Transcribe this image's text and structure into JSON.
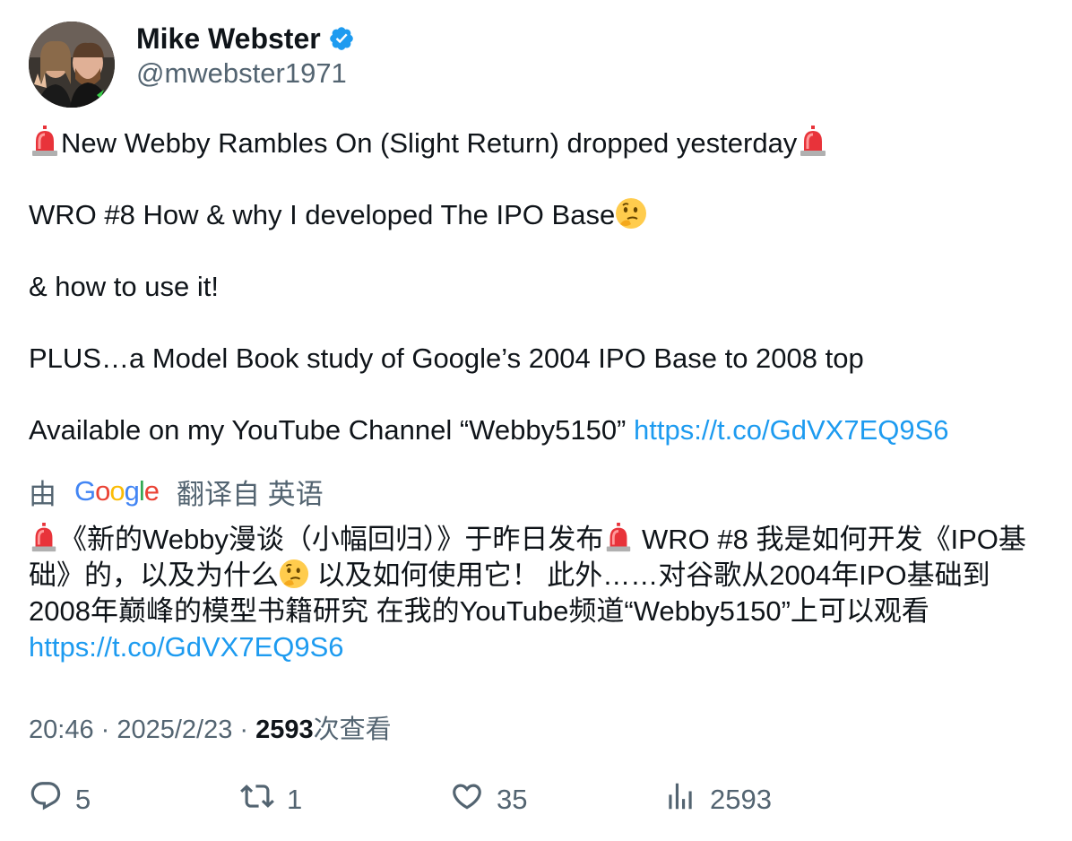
{
  "author": {
    "display_name": "Mike Webster",
    "handle": "@mwebster1971",
    "verified_icon": "verified-badge-icon",
    "avatar_icon": "avatar-photo"
  },
  "tweet": {
    "line1_text": "New Webby Rambles On (Slight Return) dropped yesterday",
    "line2_text": "WRO #8 How & why I developed The IPO Base",
    "line3_text": "& how to use it!",
    "line4_text": "PLUS…a Model Book study of Google’s 2004 IPO Base to 2008 top",
    "line5_text": "Available on my YouTube Channel “Webby5150” ",
    "link": "https://t.co/GdVX7EQ9S6",
    "emojis": [
      "rotating-light-emoji",
      "thinking-face-emoji"
    ]
  },
  "translation": {
    "prefix": "由",
    "provider": "Google",
    "suffix": "翻译自 英语",
    "part1": "《新的Webby漫谈（小幅回归）》于昨日发布",
    "part2": " WRO #8 我是如何开发《IPO基础》的，以及为什么",
    "part3": " 以及如何使用它！ 此外……对谷歌从2004年IPO基础到2008年巅峰的模型书籍研究 在我的YouTube频道“Webby5150”上可以观看 ",
    "link": "https://t.co/GdVX7EQ9S6"
  },
  "meta": {
    "time": "20:46",
    "separator": " · ",
    "date": "2025/2/23",
    "views_count": "2593",
    "views_label": "次查看"
  },
  "actions": {
    "replies": "5",
    "retweets": "1",
    "likes": "35",
    "views": "2593"
  },
  "colors": {
    "text": "#0f1419",
    "secondary": "#536471",
    "link": "#1d9bf0",
    "verified": "#1d9bf0"
  }
}
